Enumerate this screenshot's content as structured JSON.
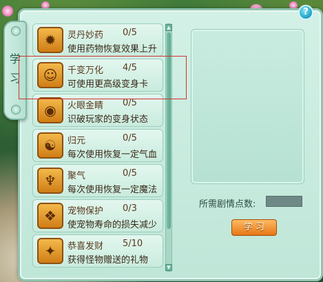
{
  "tab": {
    "label_top": "学",
    "label_bottom": "习"
  },
  "skills": [
    {
      "name": "灵丹妙药",
      "level": "0/5",
      "desc": "使用药物恢复效果上升",
      "icon": "potion-icon",
      "glyph": "✹"
    },
    {
      "name": "千变万化",
      "level": "4/5",
      "desc": "可使用更高级变身卡",
      "icon": "monkey-face-icon",
      "glyph": "☺"
    },
    {
      "name": "火眼金睛",
      "level": "0/5",
      "desc": "识破玩家的变身状态",
      "icon": "eye-icon",
      "glyph": "◉"
    },
    {
      "name": "归元",
      "level": "0/5",
      "desc": "每次使用恢复一定气血",
      "icon": "meditation-icon",
      "glyph": "☯"
    },
    {
      "name": "聚气",
      "level": "0/5",
      "desc": "每次使用恢复一定魔法",
      "icon": "energy-figure-icon",
      "glyph": "♆"
    },
    {
      "name": "宠物保护",
      "level": "0/3",
      "desc": "使宠物寿命的损失减少",
      "icon": "pet-shield-icon",
      "glyph": "❖"
    },
    {
      "name": "恭喜发财",
      "level": "5/10",
      "desc": "获得怪物赠送的礼物",
      "icon": "gold-ingot-icon",
      "glyph": "✦"
    }
  ],
  "points": {
    "label": "所需剧情点数:",
    "value": ""
  },
  "learn_button": "学   习",
  "help": "?"
}
